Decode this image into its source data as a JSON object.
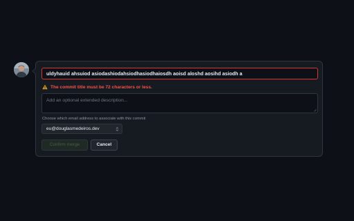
{
  "commit": {
    "title_value": "uldyhauid ahsuiod asiodashiodahsiodhasiodhaiosdh aoisd aloshd aosihd asiodh a",
    "error_message": "The commit title must be 72 characters or less.",
    "description_placeholder": "Add an optional extended description...",
    "email_label": "Choose which email address to associate with this commit",
    "email_selected": "eu@douglasmedeiros.dev"
  },
  "actions": {
    "confirm_label": "Confirm merge",
    "cancel_label": "Cancel"
  },
  "colors": {
    "background": "#0d1117",
    "card": "#161b22",
    "border": "#30363d",
    "error": "#f85149",
    "confirm_disabled_bg": "#1e2a23"
  },
  "icons": {
    "warning": "alert-triangle-icon",
    "select": "chevron-up-down-icon",
    "resize": "resize-handle-icon"
  }
}
